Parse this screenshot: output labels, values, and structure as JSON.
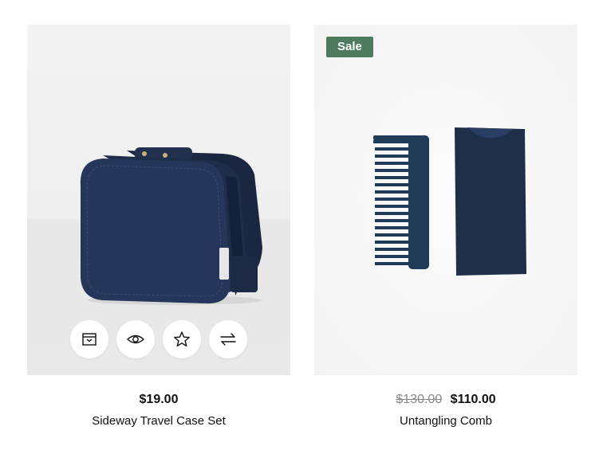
{
  "products": [
    {
      "price": "$19.00",
      "title": "Sideway Travel Case Set",
      "actions": [
        {
          "icon": "archive-box-icon"
        },
        {
          "icon": "eye-icon"
        },
        {
          "icon": "star-icon"
        },
        {
          "icon": "compare-arrows-icon"
        }
      ]
    },
    {
      "badge": "Sale",
      "old_price": "$130.00",
      "price": "$110.00",
      "title": "Untangling Comb"
    }
  ],
  "colors": {
    "badge_bg": "#4e7a5e",
    "product_navy": "#1f2e49"
  }
}
